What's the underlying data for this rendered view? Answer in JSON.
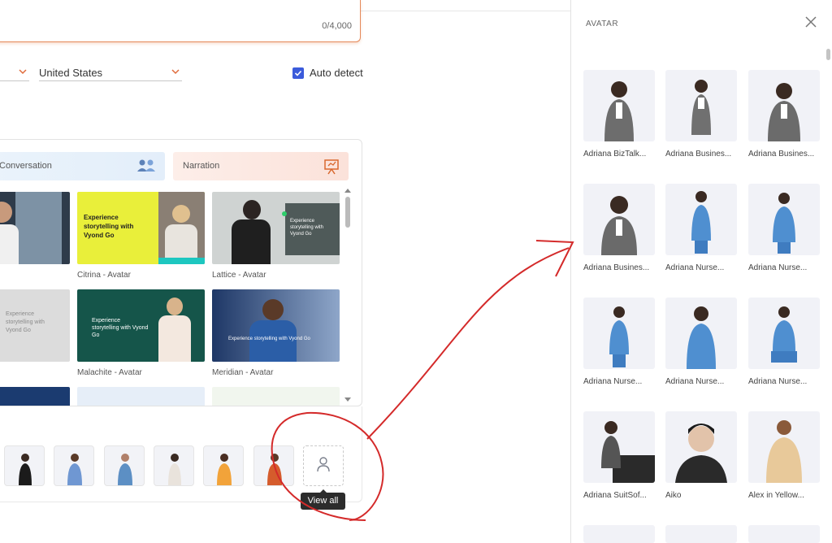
{
  "editor": {
    "char_count": "0/4,000",
    "country": "United States",
    "auto_detect_label": "Auto detect"
  },
  "categories": {
    "conversation": "Conversation",
    "narration": "Narration"
  },
  "templates": [
    {
      "label": "ar",
      "text": ""
    },
    {
      "label": "Citrina - Avatar",
      "text": "Experience storytelling with Vyond Go"
    },
    {
      "label": "Lattice - Avatar",
      "text": "Experience storytelling with Vyond Go"
    },
    {
      "label": "r",
      "text": "Experience storytelling with Vyond Go"
    },
    {
      "label": "Malachite - Avatar",
      "text": "Experience storytelling with Vyond Go"
    },
    {
      "label": "Meridian - Avatar",
      "text": "Experience storytelling with Vyond Go"
    }
  ],
  "view_all_label": "View all",
  "avatar_panel": {
    "title": "AVATAR",
    "avatars": [
      {
        "name": "Adriana BizTalk..."
      },
      {
        "name": "Adriana Busines..."
      },
      {
        "name": "Adriana Busines..."
      },
      {
        "name": "Adriana Busines..."
      },
      {
        "name": "Adriana Nurse..."
      },
      {
        "name": "Adriana Nurse..."
      },
      {
        "name": "Adriana Nurse..."
      },
      {
        "name": "Adriana Nurse..."
      },
      {
        "name": "Adriana Nurse..."
      },
      {
        "name": "Adriana SuitSof..."
      },
      {
        "name": "Aiko"
      },
      {
        "name": "Alex in Yellow..."
      }
    ]
  },
  "colors": {
    "accent_orange": "#e58a5a",
    "checkbox_blue": "#3b5bdb",
    "annotation_red": "#d42a2a"
  }
}
